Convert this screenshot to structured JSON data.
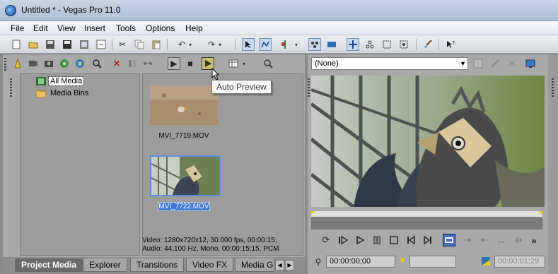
{
  "window": {
    "title": "Untitled * - Vegas Pro 11.0"
  },
  "menu": [
    "File",
    "Edit",
    "View",
    "Insert",
    "Tools",
    "Options",
    "Help"
  ],
  "main_toolbar": {
    "icons": [
      "new-project-icon",
      "open-icon",
      "save-icon",
      "save-as-icon",
      "render-icon",
      "properties-icon",
      "cut-icon",
      "copy-icon",
      "paste-icon",
      "undo-icon",
      "redo-icon",
      "normal-edit-tool-icon",
      "envelope-edit-tool-icon",
      "enable-snapping-icon",
      "auto-crossfades-icon",
      "auto-ripple-icon",
      "lock-envelopes-icon",
      "ignore-grouping-icon",
      "select-tool-icon",
      "zoom-tool-icon",
      "paint-brush-icon",
      "whats-this-help-icon"
    ]
  },
  "project_media": {
    "tree": [
      {
        "label": "All Media",
        "selected": true
      },
      {
        "label": "Media Bins",
        "selected": false
      }
    ],
    "media_items": [
      {
        "filename": "MVI_7719.MOV",
        "selected": false
      },
      {
        "filename": "MVI_7722.MOV",
        "selected": true
      }
    ],
    "info": {
      "video": "Video: 1280x720x12, 30.000 fps, 00:00:15;",
      "audio": "Audio: 44,100 Hz, Mono, 00:00:15;15, PCM"
    },
    "tooltip": "Auto Preview"
  },
  "tabs": [
    {
      "label": "Project Media",
      "active": true
    },
    {
      "label": "Explorer",
      "active": false
    },
    {
      "label": "Transitions",
      "active": false
    },
    {
      "label": "Video FX",
      "active": false
    },
    {
      "label": "Media Ge",
      "active": false
    }
  ],
  "preview": {
    "preset": "(None)",
    "timecode_current": "00:00:00;00",
    "timecode_end": "00:00:01;29"
  },
  "colors": {
    "panel_bg": "#a9a9a9",
    "selection": "#3c78d8",
    "title_gradient": "#c9d6e6"
  }
}
